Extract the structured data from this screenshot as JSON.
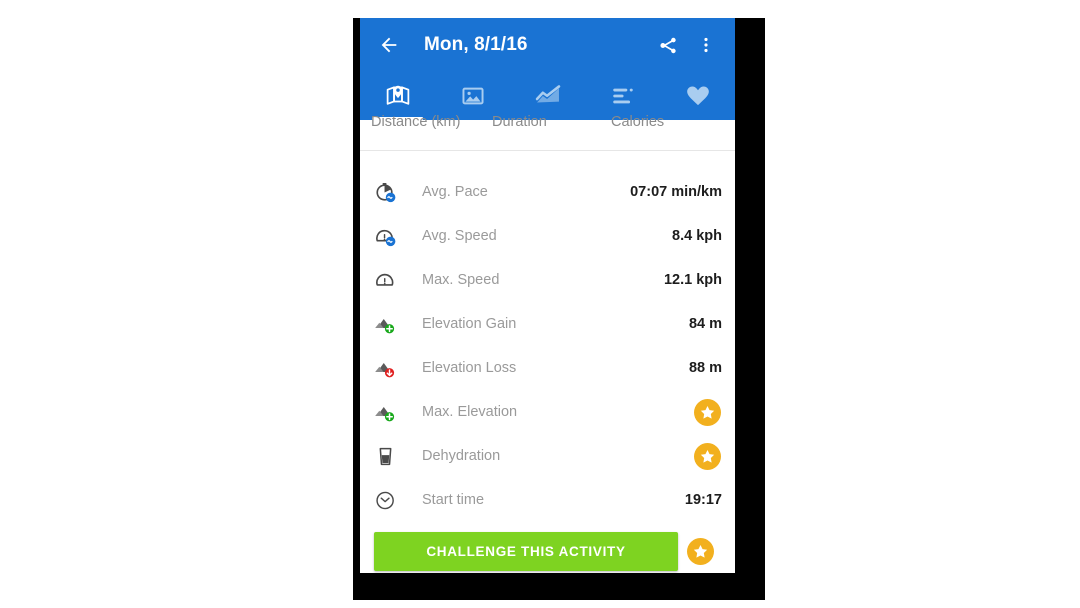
{
  "appbar": {
    "back_icon": "arrow-left-icon",
    "title": "Mon, 8/1/16",
    "share_icon": "share-icon",
    "overflow_icon": "more-vert-icon"
  },
  "tabs": [
    {
      "id": "map",
      "icon": "map-pin-icon",
      "active": true
    },
    {
      "id": "photos",
      "icon": "image-icon",
      "active": false
    },
    {
      "id": "graphs",
      "icon": "line-chart-icon",
      "active": false
    },
    {
      "id": "splits",
      "icon": "bar-list-icon",
      "active": false
    },
    {
      "id": "heart",
      "icon": "heart-icon",
      "active": false
    }
  ],
  "summary_headers": [
    "Distance (km)",
    "Duration",
    "Calories"
  ],
  "stats": [
    {
      "icon": "avg-pace-icon",
      "label": "Avg. Pace",
      "value": "07:07 min/km",
      "locked": false
    },
    {
      "icon": "avg-speed-icon",
      "label": "Avg. Speed",
      "value": "8.4 kph",
      "locked": false
    },
    {
      "icon": "max-speed-icon",
      "label": "Max. Speed",
      "value": "12.1 kph",
      "locked": false
    },
    {
      "icon": "elevation-gain-icon",
      "label": "Elevation Gain",
      "value": "84 m",
      "locked": false
    },
    {
      "icon": "elevation-loss-icon",
      "label": "Elevation Loss",
      "value": "88 m",
      "locked": false
    },
    {
      "icon": "max-elevation-icon",
      "label": "Max. Elevation",
      "value": "",
      "locked": true
    },
    {
      "icon": "dehydration-icon",
      "label": "Dehydration",
      "value": "",
      "locked": true
    },
    {
      "icon": "start-time-icon",
      "label": "Start time",
      "value": "19:17",
      "locked": false
    }
  ],
  "cta": {
    "label": "CHALLENGE THIS ACTIVITY",
    "locked": true,
    "lock_icon": "star-badge-icon"
  },
  "colors": {
    "primary_blue": "#1a73d3",
    "cta_green": "#7ed321",
    "star_gold": "#f2b01e",
    "label_gray": "#9a9a9a",
    "value_black": "#1d1d1d",
    "tab_inactive": "#a9cdf0"
  }
}
